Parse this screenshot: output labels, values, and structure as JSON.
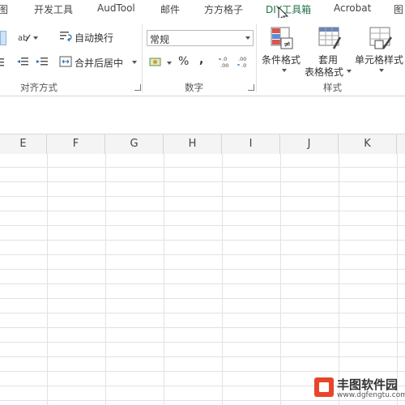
{
  "tabs": [
    "图",
    "开发工具",
    "AudTool",
    "邮件",
    "方方格子",
    "DIY工具箱",
    "Acrobat",
    "图"
  ],
  "active_tab_index": 5,
  "alignment": {
    "wrap_label": "自动换行",
    "merge_label": "合并后居中",
    "group_label": "对齐方式"
  },
  "number": {
    "format_value": "常规",
    "percent": "%",
    "comma": ",",
    "inc_decimal": ".0 .00",
    "dec_decimal": ".00 .0",
    "group_label": "数字"
  },
  "styles": {
    "cond_format_label": "条件格式",
    "table_format_line1": "套用",
    "table_format_line2": "表格格式",
    "cell_style_label": "单元格样式",
    "group_label": "样式"
  },
  "columns": [
    "E",
    "F",
    "G",
    "H",
    "I",
    "J",
    "K"
  ],
  "watermark": {
    "title": "丰图软件园",
    "url": "www.dgfengtu.com"
  },
  "colors": {
    "accent": "#217346",
    "header_bg": "#f4f4f4",
    "grid_line": "#e2e2e2"
  }
}
